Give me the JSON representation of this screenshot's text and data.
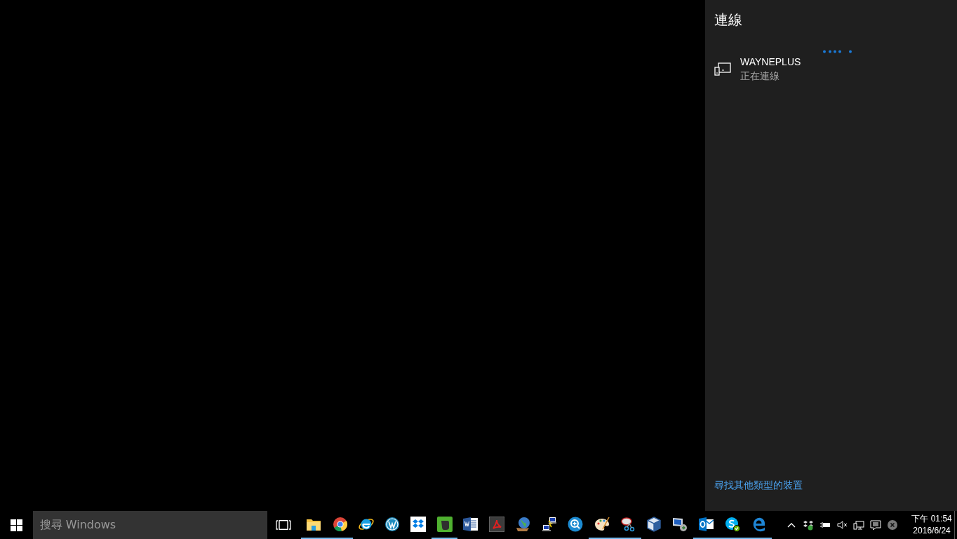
{
  "connect_panel": {
    "title": "連線",
    "devices": [
      {
        "name": "WAYNEPLUS",
        "status": "正在連線"
      }
    ],
    "link": "尋找其他類型的裝置"
  },
  "taskbar": {
    "search": {
      "placeholder": "搜尋 Windows"
    },
    "apps": [
      {
        "kind": "folder",
        "running": true
      },
      {
        "kind": "chrome",
        "running": true
      },
      {
        "kind": "ie",
        "running": false
      },
      {
        "kind": "wordpress",
        "running": false
      },
      {
        "kind": "dropbox",
        "running": false
      },
      {
        "kind": "evernote",
        "running": true
      },
      {
        "kind": "word",
        "running": false
      },
      {
        "kind": "acrobat",
        "running": false
      },
      {
        "kind": "globe",
        "running": false
      },
      {
        "kind": "network",
        "running": false
      },
      {
        "kind": "magnifier",
        "running": false
      },
      {
        "kind": "palette",
        "running": true
      },
      {
        "kind": "scissors",
        "running": true
      },
      {
        "kind": "cube",
        "running": false
      },
      {
        "kind": "remote",
        "running": false
      },
      {
        "kind": "outlook",
        "running": true
      },
      {
        "kind": "skype",
        "running": true
      },
      {
        "kind": "edge",
        "running": true
      }
    ],
    "tray": [
      {
        "kind": "chevron"
      },
      {
        "kind": "dropbox"
      },
      {
        "kind": "battery"
      },
      {
        "kind": "mute"
      },
      {
        "kind": "network"
      },
      {
        "kind": "notifications"
      },
      {
        "kind": "close"
      }
    ],
    "clock": {
      "time": "下午 01:54",
      "date": "2016/6/24"
    }
  }
}
